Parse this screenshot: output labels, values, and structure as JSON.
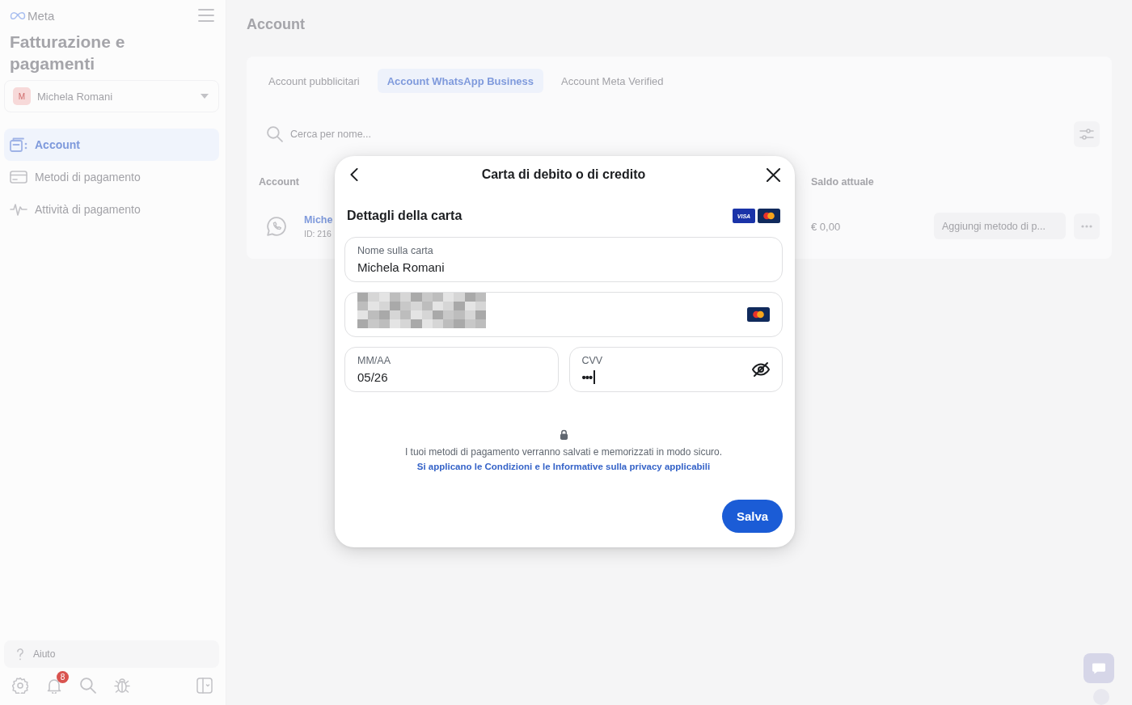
{
  "sidebar": {
    "logo": "Meta",
    "title": "Fatturazione e pagamenti",
    "account_selector": {
      "avatar": "M",
      "name": "Michela Romani"
    },
    "items": [
      {
        "kind": "accounts",
        "label": "Account",
        "selected": true
      },
      {
        "kind": "card",
        "label": "Metodi di pagamento",
        "selected": false
      },
      {
        "kind": "activity",
        "label": "Attività di pagamento",
        "selected": false
      }
    ],
    "help": "Aiuto",
    "toolbar": [
      {
        "kind": "settings"
      },
      {
        "kind": "notifications",
        "badge": "8"
      },
      {
        "kind": "search"
      },
      {
        "kind": "bug"
      },
      {
        "kind": "panel"
      }
    ]
  },
  "main": {
    "title": "Account",
    "tabs": [
      {
        "label": "Account pubblicitari",
        "selected": false
      },
      {
        "label": "Account WhatsApp Business",
        "selected": true
      },
      {
        "label": "Account Meta Verified",
        "selected": false
      }
    ],
    "search": {
      "placeholder": "Cerca per nome..."
    },
    "table": {
      "columns": [
        "Account",
        "Saldo attuale"
      ],
      "rows": [
        {
          "account_name": "Miche",
          "account_id": "ID: 216",
          "balance": "€ 0,00",
          "action": "Aggiungi metodo di p..."
        }
      ]
    }
  },
  "dialog": {
    "title": "Carta di debito o di credito",
    "section_title": "Dettagli della carta",
    "card_brands": [
      {
        "kind": "visa",
        "label": "VISA"
      },
      {
        "kind": "mastercard"
      }
    ],
    "fields": [
      {
        "kind": "text",
        "label": "Nome sulla carta",
        "value": "Michela Romani"
      },
      {
        "kind": "card_number",
        "card_icon": {
          "kind": "mastercard"
        }
      },
      {
        "kind": "text",
        "label": "MM/AA",
        "value": "05/26"
      },
      {
        "kind": "secret",
        "label": "CVV",
        "value": "•••",
        "focused": true
      }
    ],
    "notice": "I tuoi metodi di pagamento verranno salvati e memorizzati in modo sicuro.",
    "link": "Si applicano le Condizioni e le Informative sulla privacy applicabili",
    "save_button": "Salva"
  }
}
